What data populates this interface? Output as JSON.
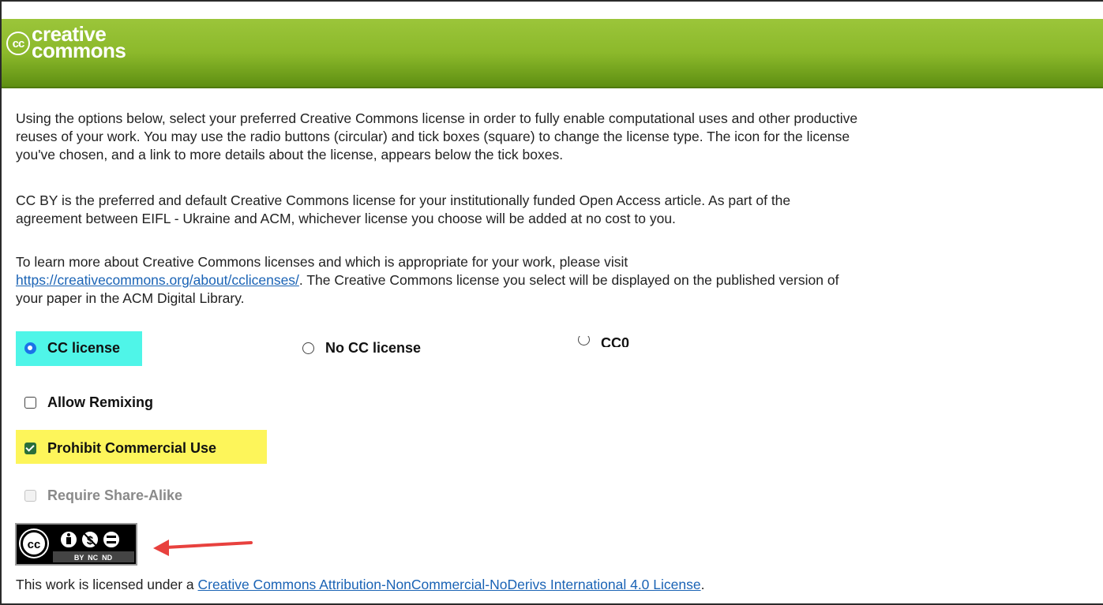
{
  "header": {
    "logo_symbol": "cc",
    "logo_line1": "creative",
    "logo_line2": "commons",
    "bg_color": "#8cb92b"
  },
  "intro": {
    "paragraph1": "Using the options below, select your preferred Creative Commons license in order to fully enable computational uses and other productive\nreuses of your work. You may use the radio buttons (circular) and tick boxes (square) to change the license type. The icon for the license\nyou've chosen, and a link to more details about the license, appears below the tick boxes.",
    "paragraph2": "CC BY is the preferred and default Creative Commons license for your institutionally funded Open Access article. As part of the\nagreement between EIFL - Ukraine and ACM, whichever license you choose will be added at no cost to you.",
    "paragraph3_before": "To learn more about Creative Commons licenses and which is appropriate for your work, please visit\n",
    "paragraph3_link": "https://creativecommons.org/about/cclicenses/",
    "paragraph3_after": ". The Creative Commons license you select will be displayed on the published version of\nyour paper in the ACM Digital Library."
  },
  "license_type": {
    "options": [
      {
        "label": "CC license",
        "selected": true
      },
      {
        "label": "No CC license",
        "selected": false
      },
      {
        "label": "CC0",
        "selected": false
      }
    ]
  },
  "modifiers": [
    {
      "label": "Allow Remixing",
      "checked": false,
      "disabled": false
    },
    {
      "label": "Prohibit Commercial Use",
      "checked": true,
      "disabled": false
    },
    {
      "label": "Require Share-Alike",
      "checked": false,
      "disabled": true
    }
  ],
  "badge": {
    "icons": [
      "cc-icon",
      "by-icon",
      "nc-icon",
      "nd-icon"
    ],
    "caption": "BY  NC  ND"
  },
  "footer": {
    "prefix": "This work is licensed under a ",
    "link": "Creative Commons Attribution-NonCommercial-NoDerivs International 4.0 License",
    "suffix": "."
  },
  "colors": {
    "highlight_cyan": "#4ff5e8",
    "highlight_yellow": "#fdf55a",
    "annotation_arrow": "#e8413e",
    "link": "#1a63b5"
  }
}
